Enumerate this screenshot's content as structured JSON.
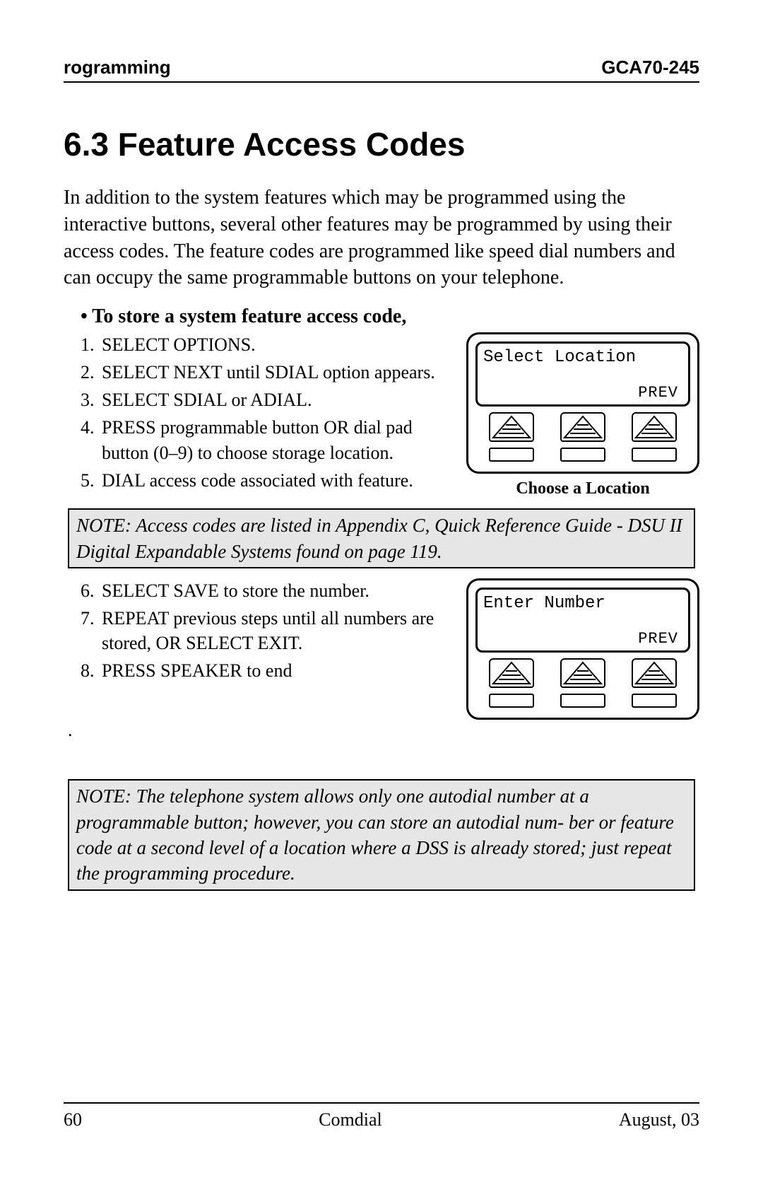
{
  "header": {
    "left": "rogramming",
    "right": "GCA70-245"
  },
  "section": {
    "number": "6.3",
    "title": "Feature Access Codes",
    "full_title": "6.3  Feature Access Codes"
  },
  "intro": "In addition to the system features which may be programmed using the interactive buttons, several other features may be programmed by using their access codes.  The feature codes are programmed like speed dial numbers and can occupy the same programmable buttons on your telephone.",
  "subhead": "To store a system feature access code,",
  "steps_a": [
    "SELECT  OPTIONS.",
    "SELECT  NEXT until  SDIAL option appears.",
    "SELECT  SDIAL  or  ADIAL.",
    "PRESS programmable button OR dial pad button (0–9) to choose storage location.",
    "DIAL access code associated with feature."
  ],
  "figure_a": {
    "lcd_line1": "Select Location",
    "lcd_line2": "PREV",
    "caption": "Choose a Location"
  },
  "note_a": "NOTE:  Access codes are listed in Appendix C, Quick Reference Guide - DSU II Digital Expandable Systems found on page 119.",
  "steps_b": [
    "SELECT  SAVE to store the number.",
    "REPEAT previous steps until all numbers are stored, OR SELECT EXIT.",
    "PRESS SPEAKER to end"
  ],
  "figure_b": {
    "lcd_line1": "Enter Number",
    "lcd_line2": "PREV",
    "caption": ""
  },
  "lone_dot": ".",
  "note_b": "NOTE: The telephone system allows only one autodial number at a programmable button; however, you can store an autodial num- ber or feature code at a second level of a location where a DSS is already stored; just repeat the programming procedure.",
  "footer": {
    "left": "60",
    "center": "Comdial",
    "right": "August, 03"
  }
}
